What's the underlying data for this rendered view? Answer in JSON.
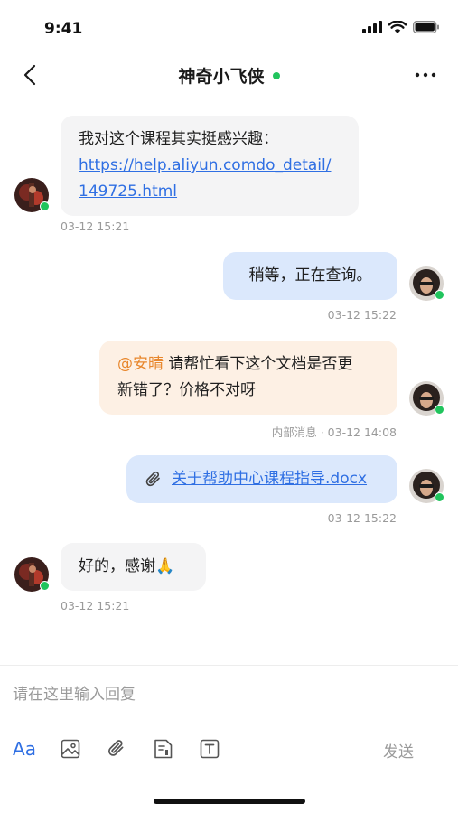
{
  "status_bar": {
    "time": "9:41"
  },
  "header": {
    "title": "神奇小飞侠",
    "online_color": "#21c45d"
  },
  "messages": [
    {
      "side": "left",
      "line1": "我对这个课程其实挺感兴趣：",
      "link_line1": "https://help.aliyun.comdo_detail/",
      "link_line2": "149725.html",
      "time": "03-12 15:21"
    },
    {
      "side": "right",
      "text": "稍等，正在查询。",
      "time": "03-12 15:22"
    },
    {
      "side": "right",
      "internal": true,
      "mention": "@安晴",
      "line1": " 请帮忙看下这个文档是否更",
      "line2": "新错了？价格不对呀",
      "meta_label": "内部消息",
      "separator": "·",
      "time": "03-12 14:08"
    },
    {
      "side": "right",
      "file_name": "关于帮助中心课程指导.docx",
      "time": "03-12 15:22"
    },
    {
      "side": "left",
      "text": "好的，感谢🙏",
      "time": "03-12 15:21"
    }
  ],
  "composer": {
    "placeholder": "请在这里输入回复",
    "format_label": "Aa",
    "send_label": "发送",
    "tools": [
      "font-format-icon",
      "image-icon",
      "attachment-icon",
      "template-icon",
      "text-box-icon"
    ]
  },
  "colors": {
    "accent": "#2f6fe3",
    "mention": "#e8872d",
    "out_bubble": "#dbe8fc",
    "in_bubble": "#f4f4f5",
    "internal_bubble": "#fdf0e4"
  }
}
